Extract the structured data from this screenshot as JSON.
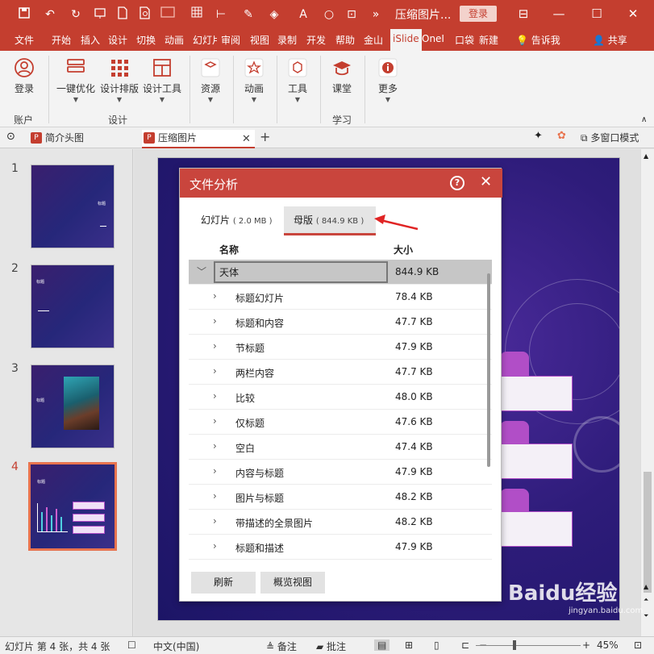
{
  "titlebar": {
    "doc_title": "压缩图片...",
    "login": "登录",
    "font_letter": "A"
  },
  "tabs": [
    "文件",
    "开始",
    "插入",
    "设计",
    "切换",
    "动画",
    "幻灯片",
    "审阅",
    "视图",
    "录制",
    "开发",
    "帮助",
    "金山",
    "iSlide",
    "OneI",
    "口袋",
    "新建"
  ],
  "active_tab": "iSlide",
  "tell_me": "告诉我",
  "share": "共享",
  "ribbon": {
    "buttons": [
      {
        "label": "登录"
      },
      {
        "label": "一键优化"
      },
      {
        "label": "设计排版"
      },
      {
        "label": "设计工具"
      },
      {
        "label": "资源"
      },
      {
        "label": "动画"
      },
      {
        "label": "工具"
      },
      {
        "label": "课堂"
      },
      {
        "label": "更多"
      }
    ],
    "groups": [
      "账户",
      "设计",
      "学习"
    ]
  },
  "doc_tabs": [
    {
      "label": "简介头图",
      "active": false
    },
    {
      "label": "压缩图片",
      "active": true
    }
  ],
  "multi_window": "多窗口模式",
  "slides": [
    "1",
    "2",
    "3",
    "4"
  ],
  "thumb_text": {
    "s1": "标题",
    "s2": "标题",
    "s3": "标题",
    "s4": "标题"
  },
  "dialog": {
    "title": "文件分析",
    "tab_slides": "幻灯片",
    "tab_slides_size": "( 2.0 MB )",
    "tab_master": "母版",
    "tab_master_size": "( 844.9 KB )",
    "col_name": "名称",
    "col_size": "大小",
    "rows": [
      {
        "name": "天体",
        "size": "844.9 KB"
      },
      {
        "name": "标题幻灯片",
        "size": "78.4 KB"
      },
      {
        "name": "标题和内容",
        "size": "47.7 KB"
      },
      {
        "name": "节标题",
        "size": "47.9 KB"
      },
      {
        "name": "两栏内容",
        "size": "47.7 KB"
      },
      {
        "name": "比较",
        "size": "48.0 KB"
      },
      {
        "name": "仅标题",
        "size": "47.6 KB"
      },
      {
        "name": "空白",
        "size": "47.4 KB"
      },
      {
        "name": "内容与标题",
        "size": "47.9 KB"
      },
      {
        "name": "图片与标题",
        "size": "48.2 KB"
      },
      {
        "name": "带描述的全景图片",
        "size": "48.2 KB"
      },
      {
        "name": "标题和描述",
        "size": "47.9 KB"
      }
    ],
    "btn_refresh": "刷新",
    "btn_overview": "概览视图"
  },
  "status": {
    "slide_info": "幻灯片 第 4 张，共 4 张",
    "language": "中文(中国)",
    "notes": "备注",
    "comments": "批注",
    "zoom": "45%"
  },
  "watermark": {
    "brand": "Baidu经验",
    "url": "jingyan.baidu.com"
  },
  "colors": {
    "accent": "#c43e2f",
    "dialog_header": "#c9453d",
    "slide_bg": "#2e1c7a"
  }
}
